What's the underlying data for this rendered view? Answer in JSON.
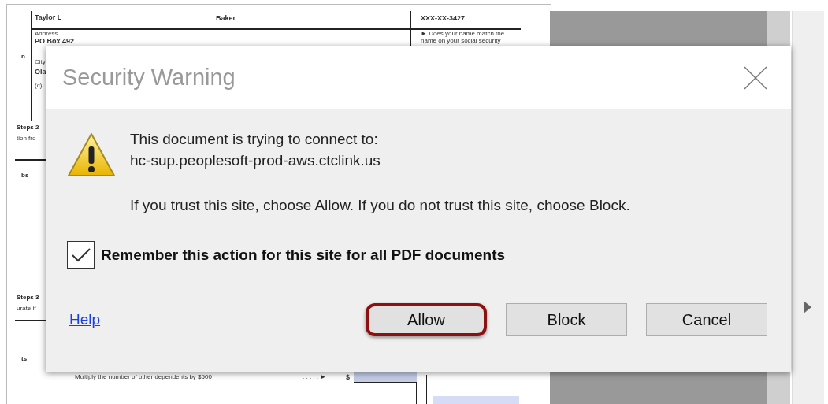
{
  "document": {
    "texts": [
      {
        "text": "Taylor L",
        "kind": "value"
      },
      {
        "text": "Baker",
        "kind": "value"
      },
      {
        "text": "XXX-XX-3427",
        "kind": "value"
      },
      {
        "text": "Address",
        "kind": "label"
      },
      {
        "text": "PO Box 492",
        "kind": "value"
      },
      {
        "text": "► Does your name match the",
        "kind": "note"
      },
      {
        "text": "name on your social security",
        "kind": "note"
      },
      {
        "text": "n",
        "kind": "heading"
      },
      {
        "text": "City",
        "kind": "label"
      },
      {
        "text": "Ola",
        "kind": "value"
      },
      {
        "text": "(c)",
        "kind": "label"
      },
      {
        "text": "Steps 2-",
        "kind": "heading"
      },
      {
        "text": "tion fro",
        "kind": "note"
      },
      {
        "text": "bs",
        "kind": "heading"
      },
      {
        "text": "Steps 3-",
        "kind": "heading"
      },
      {
        "text": "urate if",
        "kind": "note"
      },
      {
        "text": "ts",
        "kind": "heading"
      },
      {
        "text": "Multiply the number of other dependents by $500",
        "kind": "note"
      },
      {
        "text": ". . . . . ►",
        "kind": "note"
      },
      {
        "text": "$",
        "kind": "value"
      }
    ]
  },
  "dialog": {
    "title": "Security Warning",
    "message_lines": [
      "This document is trying to connect to:",
      "hc-sup.peoplesoft-prod-aws.ctclink.us"
    ],
    "advice": "If you trust this site, choose Allow. If you do not trust this site, choose Block.",
    "remember": {
      "label": "Remember this action for this site for all PDF documents",
      "checked": true
    },
    "help_link": "Help",
    "buttons": [
      {
        "label": "Allow",
        "selected": true
      },
      {
        "label": "Block",
        "selected": false
      },
      {
        "label": "Cancel",
        "selected": false
      }
    ]
  }
}
